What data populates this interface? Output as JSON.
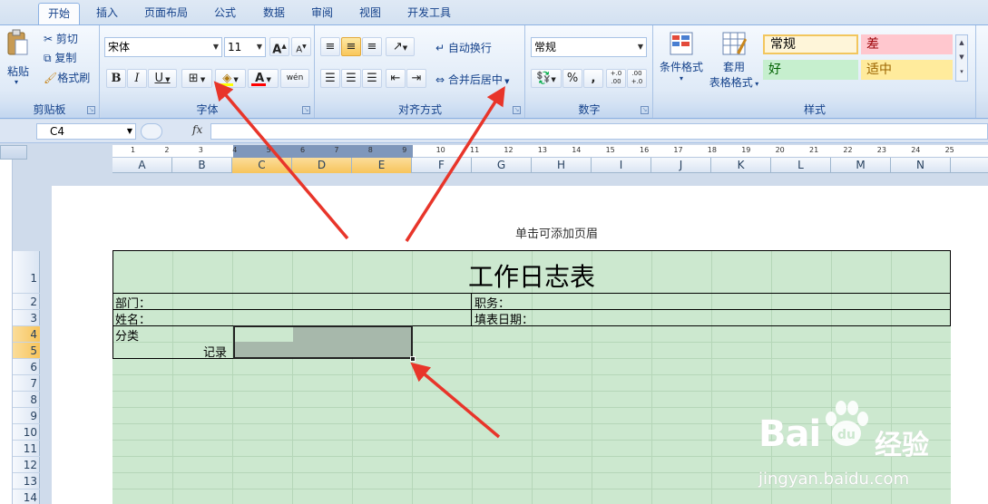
{
  "tabs": [
    "开始",
    "插入",
    "页面布局",
    "公式",
    "数据",
    "审阅",
    "视图",
    "开发工具"
  ],
  "clipboard": {
    "paste": "粘贴",
    "cut": "剪切",
    "copy": "复制",
    "format_painter": "格式刷",
    "label": "剪贴板"
  },
  "font": {
    "name": "宋体",
    "size": "11",
    "bold": "B",
    "italic": "I",
    "underline": "U",
    "label": "字体",
    "phonetic": "wén"
  },
  "alignment": {
    "wrap": "自动换行",
    "merge": "合并后居中",
    "label": "对齐方式"
  },
  "number": {
    "format": "常规",
    "percent": "%",
    "comma": ",",
    "inc_decimal": "+.0 .00",
    "dec_decimal": ".00 +.0",
    "label": "数字"
  },
  "styles": {
    "conditional": "条件格式",
    "table": "套用",
    "table2": "表格格式",
    "normal": "常规",
    "bad": "差",
    "good": "好",
    "neutral": "适中",
    "label": "样式"
  },
  "formula_bar": {
    "name_box": "C4",
    "fx": "fx",
    "content": ""
  },
  "columns": [
    "A",
    "B",
    "C",
    "D",
    "E",
    "F",
    "G",
    "H",
    "I",
    "J",
    "K",
    "L",
    "M",
    "N"
  ],
  "rows": [
    "1",
    "2",
    "3",
    "4",
    "5",
    "6",
    "7",
    "8",
    "9",
    "10",
    "11",
    "12",
    "13",
    "14"
  ],
  "ruler_numbers": [
    "1",
    "2",
    "3",
    "4",
    "5",
    "6",
    "7",
    "8",
    "9",
    "10",
    "11",
    "12",
    "13",
    "14",
    "15",
    "16",
    "17",
    "18",
    "19",
    "20",
    "21",
    "22",
    "23",
    "24",
    "25"
  ],
  "sheet": {
    "header_hint": "单击可添加页眉",
    "title": "工作日志表",
    "department": "部门：",
    "position": "职务：",
    "name": "姓名：",
    "date": "填表日期：",
    "category": "分类",
    "record": "记录"
  },
  "watermark": {
    "brand": "Bai",
    "brand2": "du",
    "jingyan": "经验",
    "url": "jingyan.baidu.com"
  },
  "colors": {
    "accent": "#e8352a",
    "sheet_bg": "#cce8cf",
    "ribbon_blue": "#15428b",
    "selection": "#a7b8ab"
  }
}
